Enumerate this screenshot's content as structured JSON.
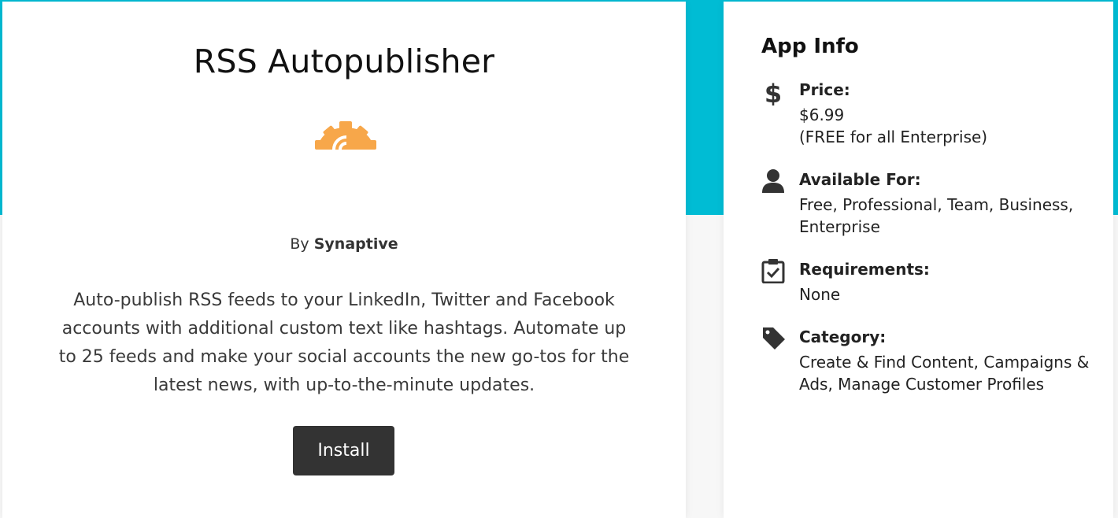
{
  "colors": {
    "accent_band": "#00bcd4",
    "install_button": "#333333",
    "logo_orange": "#f7a74a"
  },
  "app": {
    "title": "RSS Autopublisher",
    "logo_icon": "rss-gear-logo",
    "by_prefix": "By",
    "vendor": "Synaptive",
    "description": "Auto-publish RSS feeds to your LinkedIn, Twitter and Facebook accounts with additional custom text like hashtags. Automate up to 25 feeds and make your social accounts the new go-tos for the latest news, with up-to-the-minute updates.",
    "install_label": "Install"
  },
  "app_info": {
    "title": "App Info",
    "price": {
      "icon": "dollar-icon",
      "label": "Price:",
      "value_line1": "$6.99",
      "value_line2": "(FREE for all Enterprise)"
    },
    "available_for": {
      "icon": "user-icon",
      "label": "Available For:",
      "value": "Free, Professional, Team, Business, Enterprise"
    },
    "requirements": {
      "icon": "clipboard-check-icon",
      "label": "Requirements:",
      "value": "None"
    },
    "category": {
      "icon": "tag-icon",
      "label": "Category:",
      "value": "Create & Find Content, Campaigns & Ads, Manage Customer Profiles"
    }
  }
}
